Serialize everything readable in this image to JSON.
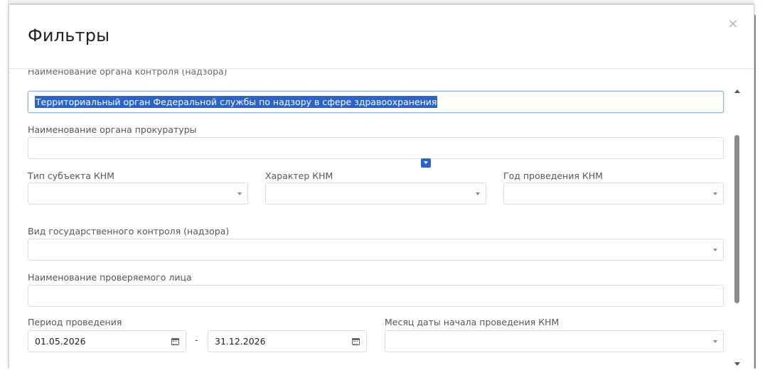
{
  "modal": {
    "title": "Фильтры",
    "close_icon": "×"
  },
  "fields": {
    "control_body": {
      "label": "Наименование органа контроля (надзора)",
      "value": "Территориальный орган Федеральной службы по надзору в сфере здравоохранения"
    },
    "prosecutor": {
      "label": "Наименование органа прокуратуры",
      "value": ""
    },
    "subject_type": {
      "label": "Тип субъекта КНМ",
      "value": ""
    },
    "knm_character": {
      "label": "Характер КНМ",
      "value": ""
    },
    "knm_year": {
      "label": "Год проведения КНМ",
      "value": ""
    },
    "control_type": {
      "label": "Вид государственного контроля (надзора)",
      "value": ""
    },
    "inspected_entity": {
      "label": "Наименование проверяемого лица",
      "value": ""
    },
    "period": {
      "label": "Период проведения",
      "from": "01.05.2026",
      "separator": "-",
      "to": "31.12.2026"
    },
    "start_month": {
      "label": "Месяц даты начала проведения КНМ",
      "value": ""
    }
  },
  "icons": {
    "close": "close-icon",
    "dropdown": "chevron-down-icon",
    "calendar": "calendar-icon"
  },
  "colors": {
    "selection": "#2a63c9",
    "focus_border": "#8cb4e8"
  }
}
